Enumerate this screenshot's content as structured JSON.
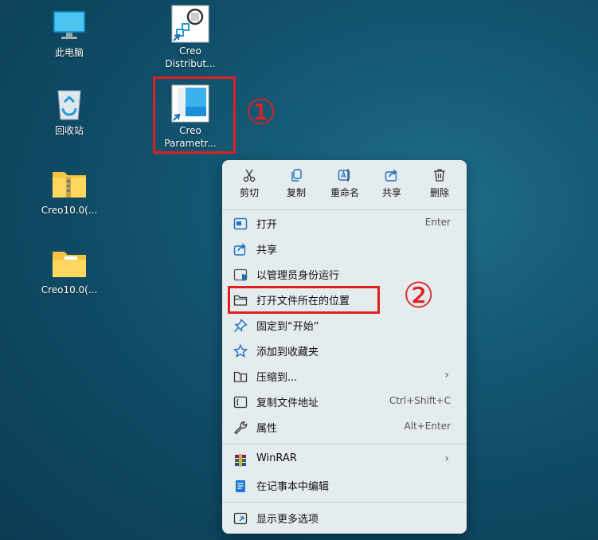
{
  "desktop": {
    "icons": [
      {
        "label": "此电脑"
      },
      {
        "label": "Creo\nDistribut..."
      },
      {
        "label": "回收站"
      },
      {
        "label": "Creo\nParametr..."
      },
      {
        "label": "Creo10.0(..."
      },
      {
        "label": "Creo10.0(..."
      }
    ]
  },
  "annotations": {
    "one": "①",
    "two": "②"
  },
  "context_menu": {
    "quick_actions": [
      {
        "label": "剪切",
        "icon": "scissors-icon"
      },
      {
        "label": "复制",
        "icon": "copy-icon"
      },
      {
        "label": "重命名",
        "icon": "rename-icon"
      },
      {
        "label": "共享",
        "icon": "share-icon"
      },
      {
        "label": "删除",
        "icon": "trash-icon"
      }
    ],
    "items": [
      {
        "label": "打开",
        "shortcut": "Enter",
        "icon": "open-icon"
      },
      {
        "label": "共享",
        "shortcut": "",
        "icon": "share-icon"
      },
      {
        "label": "以管理员身份运行",
        "shortcut": "",
        "icon": "shield-icon"
      },
      {
        "label": "打开文件所在的位置",
        "shortcut": "",
        "icon": "folder-icon"
      },
      {
        "label": "固定到“开始”",
        "shortcut": "",
        "icon": "pin-icon"
      },
      {
        "label": "添加到收藏夹",
        "shortcut": "",
        "icon": "star-icon"
      },
      {
        "label": "压缩到...",
        "shortcut": "",
        "icon": "zip-icon"
      },
      {
        "label": "复制文件地址",
        "shortcut": "Ctrl+Shift+C",
        "icon": "copy-path-icon"
      },
      {
        "label": "属性",
        "shortcut": "Alt+Enter",
        "icon": "wrench-icon"
      },
      {
        "label": "WinRAR",
        "shortcut": "",
        "icon": "winrar-icon"
      },
      {
        "label": "在记事本中编辑",
        "shortcut": "",
        "icon": "notepad-icon"
      },
      {
        "label": "显示更多选项",
        "shortcut": "",
        "icon": "more-options-icon"
      }
    ],
    "submenu_arrow": "›"
  }
}
